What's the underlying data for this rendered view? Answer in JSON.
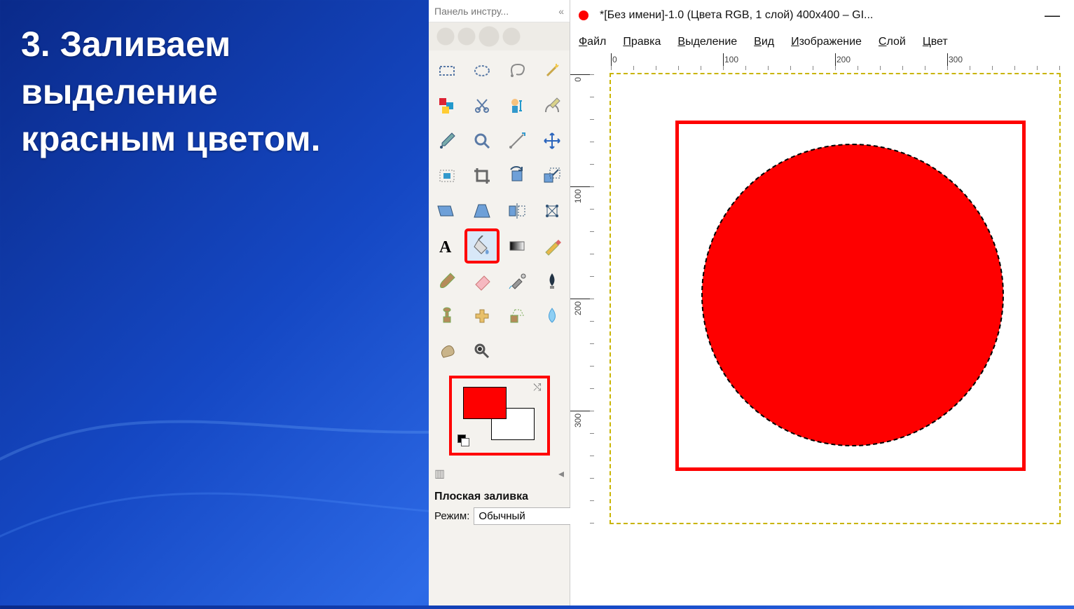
{
  "slide": {
    "text": "3. Заливаем\nвыделение\nкрасным цветом."
  },
  "toolbox": {
    "header": "Панель инстру...",
    "header_close": "«",
    "tools": [
      {
        "name": "rect-select",
        "icon": "rect"
      },
      {
        "name": "ellipse-select",
        "icon": "ellipse"
      },
      {
        "name": "free-select",
        "icon": "lasso"
      },
      {
        "name": "fuzzy-select",
        "icon": "wand"
      },
      {
        "name": "by-color-select",
        "icon": "bycolor"
      },
      {
        "name": "scissors-select",
        "icon": "scissors"
      },
      {
        "name": "foreground-select",
        "icon": "fg"
      },
      {
        "name": "paths-tool",
        "icon": "pen"
      },
      {
        "name": "color-picker",
        "icon": "dropper"
      },
      {
        "name": "zoom-tool",
        "icon": "loupe"
      },
      {
        "name": "measure-tool",
        "icon": "measure"
      },
      {
        "name": "move-tool",
        "icon": "move"
      },
      {
        "name": "align-tool",
        "icon": "align"
      },
      {
        "name": "crop-tool",
        "icon": "crop"
      },
      {
        "name": "rotate-tool",
        "icon": "rotate"
      },
      {
        "name": "scale-tool",
        "icon": "scale"
      },
      {
        "name": "shear-tool",
        "icon": "shear"
      },
      {
        "name": "perspective-tool",
        "icon": "persp"
      },
      {
        "name": "flip-tool",
        "icon": "flip"
      },
      {
        "name": "cage-tool",
        "icon": "cage"
      },
      {
        "name": "text-tool",
        "icon": "text"
      },
      {
        "name": "bucket-fill",
        "icon": "bucket",
        "highlight": true
      },
      {
        "name": "blend-tool",
        "icon": "gradient"
      },
      {
        "name": "pencil-tool",
        "icon": "pencil"
      },
      {
        "name": "paintbrush-tool",
        "icon": "brush"
      },
      {
        "name": "eraser-tool",
        "icon": "eraser"
      },
      {
        "name": "airbrush-tool",
        "icon": "airbrush"
      },
      {
        "name": "ink-tool",
        "icon": "ink"
      },
      {
        "name": "clone-tool",
        "icon": "stamp"
      },
      {
        "name": "heal-tool",
        "icon": "heal"
      },
      {
        "name": "perspective-clone",
        "icon": "pclone"
      },
      {
        "name": "blur-tool",
        "icon": "blur"
      },
      {
        "name": "smudge-tool",
        "icon": "smudge"
      },
      {
        "name": "dodge-tool",
        "icon": "dodge"
      }
    ],
    "colors": {
      "foreground": "#fe0000",
      "background": "#ffffff"
    },
    "options_title": "Плоская заливка",
    "mode_label": "Режим:",
    "mode_value": "Обычный"
  },
  "image_window": {
    "title": "*[Без имени]-1.0 (Цвета RGB, 1 слой) 400x400 – GI...",
    "minimize": "—",
    "menus": [
      "Файл",
      "Правка",
      "Выделение",
      "Вид",
      "Изображение",
      "Слой",
      "Цвет"
    ],
    "ruler_labels_h": [
      "0",
      "100",
      "200",
      "300"
    ],
    "ruler_labels_v": [
      "0",
      "100",
      "200",
      "300"
    ]
  }
}
